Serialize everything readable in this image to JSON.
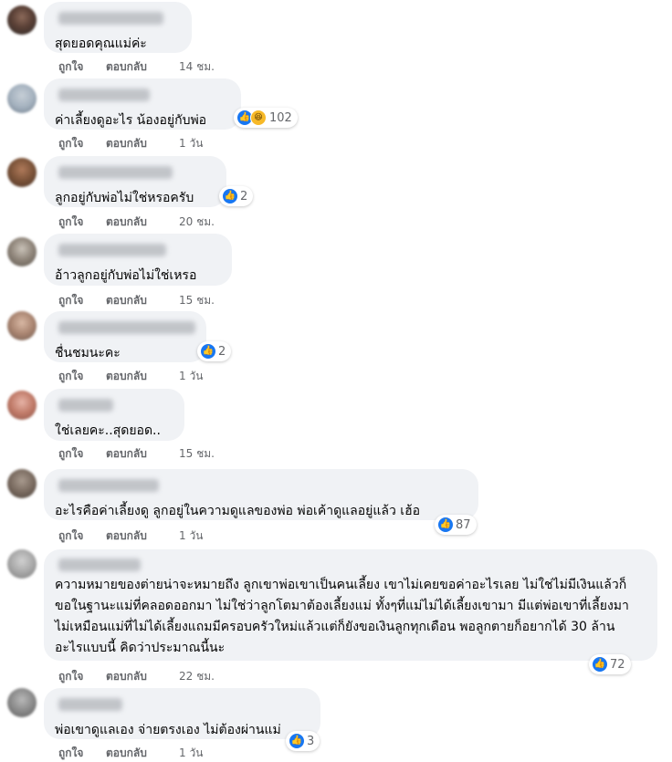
{
  "actions": {
    "like": "ถูกใจ",
    "reply": "ตอบกลับ"
  },
  "colors": {
    "bubble": "#f0f2f5",
    "like_blue": "#1877f2",
    "haha_yellow": "#f7b928",
    "meta_gray": "#65676b"
  },
  "comments": [
    {
      "text": "สุดยอดคุณแม่ค่ะ",
      "time": "14 ชม.",
      "reactions": "",
      "icons": []
    },
    {
      "text": "ค่าเลี้ยงดูอะไร น้องอยู่กับพ่อ",
      "time": "1 วัน",
      "reactions": "102",
      "icons": [
        "like-icon",
        "haha-icon"
      ]
    },
    {
      "text": "ลูกอยู่กับพ่อไม่ใช่หรอครับ",
      "time": "20 ชม.",
      "reactions": "2",
      "icons": [
        "like-icon"
      ]
    },
    {
      "text": "อ้าวลูกอยู่กับพ่อไม่ใช่เหรอ",
      "time": "15 ชม.",
      "reactions": "",
      "icons": []
    },
    {
      "text": "ชื่นชมนะคะ",
      "time": "1 วัน",
      "reactions": "2",
      "icons": [
        "like-icon"
      ]
    },
    {
      "text": "ใช่เลยคะ..สุดยอด..",
      "time": "15 ชม.",
      "reactions": "",
      "icons": []
    },
    {
      "text": "อะไรคือค่าเลี้ยงดู ลูกอยู่ในความดูแลของพ่อ พ่อเค้าดูแลอยู่แล้ว เฮ้อ",
      "time": "1 วัน",
      "reactions": "87",
      "icons": [
        "like-icon"
      ]
    },
    {
      "text": "ความหมายของต่ายน่าจะหมายถึง ลูกเขาพ่อเขาเป็นคนเลี้ยง เขาไม่เคยขอค่าอะไรเลย ไม่ใช่ไม่มีเงินแล้วก็ขอในฐานะแม่ที่คลอดออกมา ไม่ใช่ว่าลูกโตมาต้องเลี้ยงแม่ ทั้งๆที่แม่ไม่ได้เลี้ยงเขามา มีแต่พ่อเขาที่เลี้ยงมา ไม่เหมือนแม่ที่ไม่ได้เลี้ยงแถมมีครอบครัวใหม่แล้วแต่ก็ยังขอเงินลูกทุกเดือน พอลูกตายก็อยากได้ 30 ล้านอะไรแบบนี้ คิดว่าประมาณนี้นะ",
      "time": "22 ชม.",
      "reactions": "72",
      "icons": [
        "like-icon"
      ]
    },
    {
      "text": "พ่อเขาดูแลเอง จ่ายตรงเอง ไม่ต้องผ่านแม่",
      "time": "1 วัน",
      "reactions": "3",
      "icons": [
        "like-icon"
      ]
    }
  ]
}
